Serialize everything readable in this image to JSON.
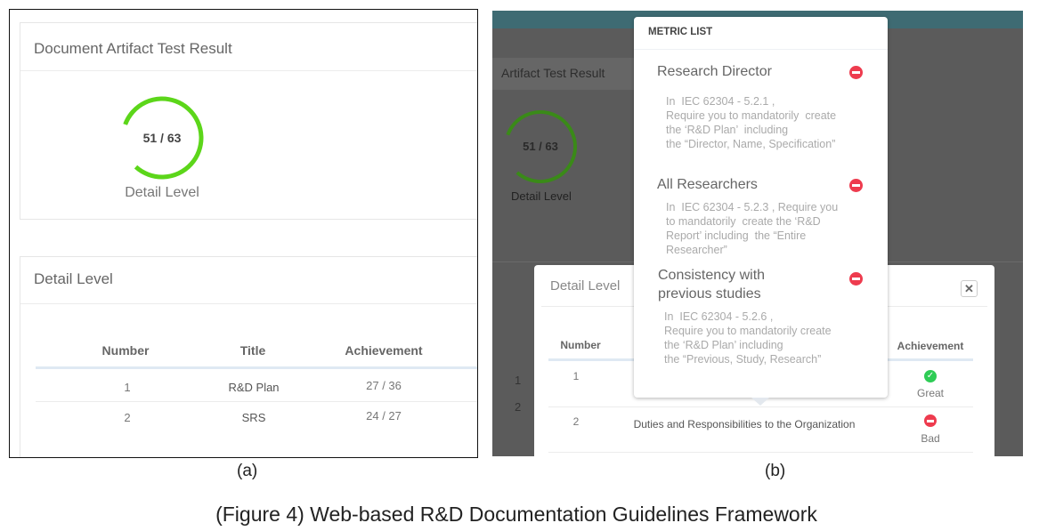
{
  "panel_a": {
    "result_card": {
      "title": "Document Artifact Test Result",
      "gauge_value": "51 / 63",
      "gauge_fraction": 0.81,
      "gauge_label": "Detail Level",
      "gauge_color": "#5cd61a"
    },
    "detail_card": {
      "title": "Detail Level",
      "columns": [
        "Number",
        "Title",
        "Achievement"
      ],
      "rows": [
        {
          "number": "1",
          "title": "R&D Plan",
          "achievement": "27 / 36"
        },
        {
          "number": "2",
          "title": "SRS",
          "achievement": "24 / 27"
        }
      ]
    },
    "label": "(a)"
  },
  "panel_b": {
    "background": {
      "title": "Artifact Test Result",
      "gauge_value": "51 / 63",
      "gauge_label": "Detail Level",
      "row_numbers": [
        "1",
        "2"
      ]
    },
    "modal": {
      "title": "Detail Level",
      "close_icon": "close-icon",
      "columns": [
        "Number",
        "Achievement"
      ],
      "rows": [
        {
          "number": "1",
          "title": "",
          "status": "Great",
          "status_icon": "check-icon",
          "status_color": "#2ecc55"
        },
        {
          "number": "2",
          "title": "Duties and Responsibilities to the Organization",
          "status": "Bad",
          "status_icon": "minus-icon",
          "status_color": "#ee3b4e"
        }
      ]
    },
    "metric_list": {
      "title": "METRIC LIST",
      "items": [
        {
          "name": "Research Director",
          "text": "In  IEC 62304 - 5.2.1 ,\nRequire you to mandatorily  create\nthe ‘R&D Plan’  including\nthe “Director, Name, Specification”"
        },
        {
          "name": "All Researchers",
          "text": "In  IEC 62304 - 5.2.3 , Require you\nto mandatorily  create the ‘R&D\nReport’ including  the “Entire\nResearcher”"
        },
        {
          "name": "Consistency with\nprevious studies",
          "text": "In  IEC 62304 - 5.2.6 ,\nRequire you to mandatorily create\nthe ‘R&D Plan’ including\nthe “Previous, Study, Research”"
        }
      ]
    },
    "label": "(b)"
  },
  "caption": "(Figure 4) Web-based R&D Documentation Guidelines Framework"
}
